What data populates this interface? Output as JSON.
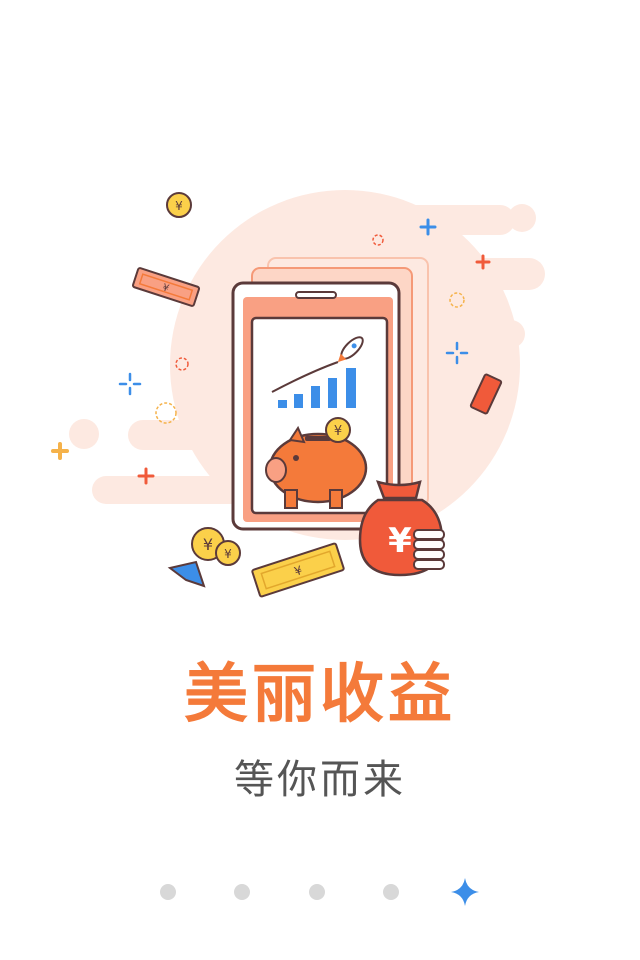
{
  "onboarding": {
    "title": "美丽收益",
    "subtitle": "等你而来",
    "illustration_icon": "phone-piggy-bank-money-icon",
    "page_indicator": {
      "total": 5,
      "active_index": 5,
      "active_icon": "sparkle-star-icon"
    }
  },
  "colors": {
    "accent": "#f47a3a",
    "text": "#555555",
    "dot_inactive": "#d8d8d8",
    "dot_active": "#3c8ee8"
  }
}
